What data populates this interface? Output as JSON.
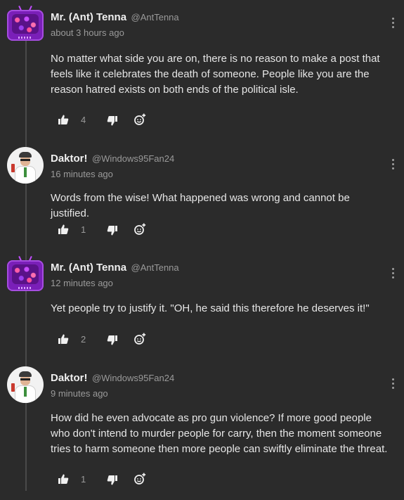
{
  "comments": [
    {
      "name": "Mr. (Ant) Tenna",
      "handle": "@AntTenna",
      "time": "about 3 hours ago",
      "body": "No matter what side you are on, there is no reason to make a post that feels like it celebrates the death of someone. People like you are the reason hatred exists on both ends of the political isle.",
      "likes": "4",
      "avatar_icon": "tv-avatar-icon"
    },
    {
      "name": "Daktor!",
      "handle": "@Windows95Fan24",
      "time": "16 minutes ago",
      "body": "Words from the wise! What happened was wrong and cannot be justified.",
      "likes": "1",
      "avatar_icon": "doctor-avatar-icon"
    },
    {
      "name": "Mr. (Ant) Tenna",
      "handle": "@AntTenna",
      "time": "12 minutes ago",
      "body": "Yet people try to justify it. \"OH, he said this therefore he deserves it!\"",
      "likes": "2",
      "avatar_icon": "tv-avatar-icon"
    },
    {
      "name": "Daktor!",
      "handle": "@Windows95Fan24",
      "time": "9 minutes ago",
      "body": "How did he even advocate as pro gun violence? If more good people who don't intend to murder people for carry, then the moment someone tries to harm someone then more people can swiftly eliminate the threat.",
      "likes": "1",
      "avatar_icon": "doctor-avatar-icon"
    }
  ],
  "colors": {
    "background": "#2b2b2b",
    "text": "#e6e6e6",
    "muted": "#9a9a9a",
    "accent_purple": "#7a1fb8"
  }
}
